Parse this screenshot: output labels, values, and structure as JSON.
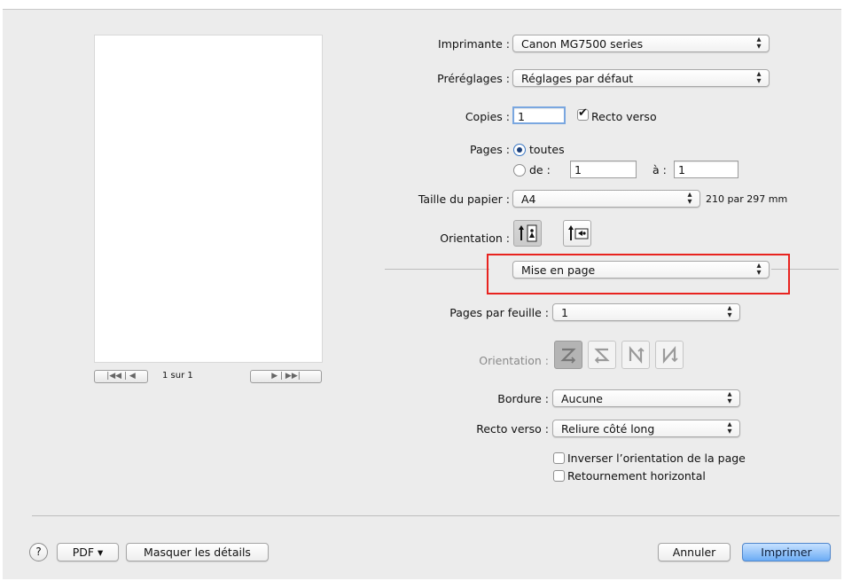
{
  "printer": {
    "label": "Imprimante :",
    "value": "Canon MG7500 series"
  },
  "presets": {
    "label": "Préréglages :",
    "value": "Réglages par défaut"
  },
  "copies": {
    "label": "Copies :",
    "value": "1",
    "duplex_label": "Recto verso",
    "duplex_checked": true
  },
  "pages": {
    "label": "Pages :",
    "all_label": "toutes",
    "from_label": "de :",
    "from_value": "1",
    "to_label": "à :",
    "to_value": "1"
  },
  "paper_size": {
    "label": "Taille du papier :",
    "value": "A4",
    "dims": "210 par 297 mm"
  },
  "orientation": {
    "label": "Orientation :"
  },
  "section": {
    "value": "Mise en page",
    "highlight_color": "#e8231f"
  },
  "layout": {
    "pages_per_sheet_label": "Pages par feuille :",
    "pages_per_sheet_value": "1",
    "direction_label": "Orientation :",
    "border_label": "Bordure :",
    "border_value": "Aucune",
    "two_sided_label": "Recto verso :",
    "two_sided_value": "Reliure côté long",
    "reverse_label": "Inverser l’orientation de la page",
    "flip_label": "Retournement horizontal"
  },
  "preview": {
    "page_indicator": "1 sur 1",
    "first_prev": "|◀◀ | ◀",
    "next_last": "▶ | ▶▶|"
  },
  "footer": {
    "help": "?",
    "pdf": "PDF ▾",
    "hide_details": "Masquer les détails",
    "cancel": "Annuler",
    "print": "Imprimer"
  }
}
